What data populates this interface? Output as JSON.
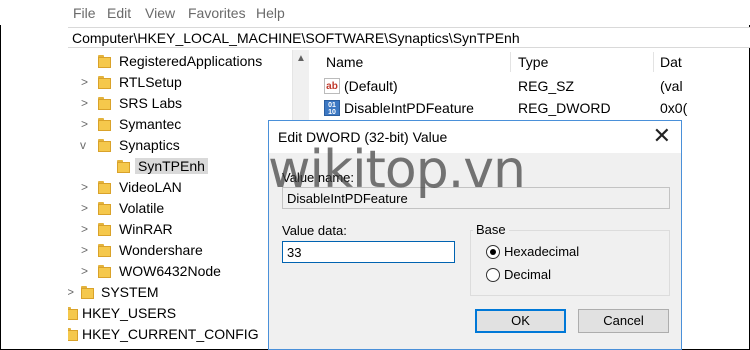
{
  "menu": [
    "File",
    "Edit",
    "View",
    "Favorites",
    "Help"
  ],
  "address": "Computer\\HKEY_LOCAL_MACHINE\\SOFTWARE\\Synaptics\\SynTPEnh",
  "tree": {
    "items": [
      {
        "label": "RegisteredApplications",
        "expander": "",
        "selected": false
      },
      {
        "label": "RTLSetup",
        "expander": ">",
        "selected": false
      },
      {
        "label": "SRS Labs",
        "expander": ">",
        "selected": false
      },
      {
        "label": "Symantec",
        "expander": ">",
        "selected": false
      },
      {
        "label": "Synaptics",
        "expander": "v",
        "selected": false
      },
      {
        "label": "SynTPEnh",
        "expander": "",
        "selected": true
      },
      {
        "label": "VideoLAN",
        "expander": ">",
        "selected": false
      },
      {
        "label": "Volatile",
        "expander": ">",
        "selected": false
      },
      {
        "label": "WinRAR",
        "expander": ">",
        "selected": false
      },
      {
        "label": "Wondershare",
        "expander": ">",
        "selected": false
      },
      {
        "label": "WOW6432Node",
        "expander": ">",
        "selected": false
      },
      {
        "label": "SYSTEM",
        "expander": ">",
        "selected": false
      },
      {
        "label": "HKEY_USERS",
        "expander": ">",
        "selected": false
      },
      {
        "label": "HKEY_CURRENT_CONFIG",
        "expander": ">",
        "selected": false
      }
    ]
  },
  "values": {
    "headers": [
      "Name",
      "Type",
      "Dat"
    ],
    "rows": [
      {
        "icon": "ab",
        "name": "(Default)",
        "type": "REG_SZ",
        "data": "(val"
      },
      {
        "icon": "dword",
        "name": "DisableIntPDFeature",
        "type": "REG_DWORD",
        "data": "0x0("
      }
    ]
  },
  "dialog": {
    "title": "Edit DWORD (32-bit) Value",
    "close_glyph": "✕",
    "value_name_label": "Value name:",
    "value_name": "DisableIntPDFeature",
    "value_data_label": "Value data:",
    "value_data": "33",
    "base_label": "Base",
    "hex_label": "Hexadecimal",
    "dec_label": "Decimal",
    "base_selected": "Hexadecimal",
    "ok_label": "OK",
    "cancel_label": "Cancel"
  },
  "watermark": "wikitop.vn",
  "colors": {
    "folder": "#f5c84c",
    "dialog_border": "#4a90d9",
    "default_button_border": "#0078d7",
    "selection": "#d9d9d9"
  }
}
